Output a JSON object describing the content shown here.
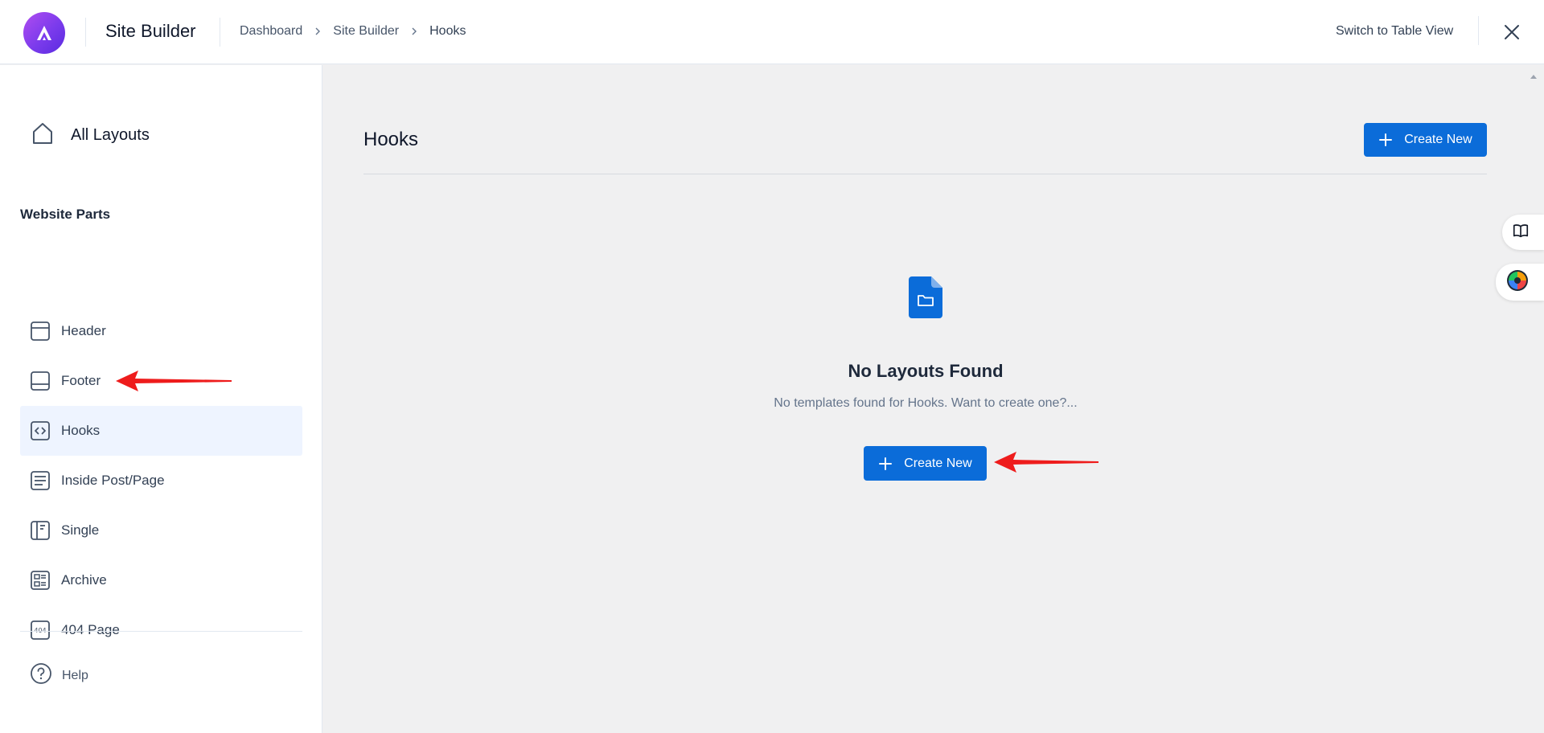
{
  "header": {
    "app_title": "Site Builder",
    "breadcrumb": [
      "Dashboard",
      "Site Builder",
      "Hooks"
    ],
    "switch_view_label": "Switch to Table View",
    "icons": {
      "logo": "astra-logo-icon",
      "close": "close-icon",
      "separator": "chevron-right-icon"
    }
  },
  "sidebar": {
    "all_layouts_label": "All Layouts",
    "section_title": "Website Parts",
    "items": [
      {
        "label": "Header",
        "icon": "header-layout-icon",
        "active": false
      },
      {
        "label": "Footer",
        "icon": "footer-layout-icon",
        "active": false
      },
      {
        "label": "Hooks",
        "icon": "code-icon",
        "active": true
      },
      {
        "label": "Inside Post/Page",
        "icon": "inside-post-icon",
        "active": false
      },
      {
        "label": "Single",
        "icon": "single-layout-icon",
        "active": false
      },
      {
        "label": "Archive",
        "icon": "archive-layout-icon",
        "active": false
      },
      {
        "label": "404 Page",
        "icon": "404-page-icon",
        "active": false
      }
    ],
    "help_label": "Help"
  },
  "main": {
    "title": "Hooks",
    "create_new_label": "Create New",
    "empty_state": {
      "title": "No Layouts Found",
      "description": "No templates found for Hooks. Want to create one?...",
      "create_new_label": "Create New",
      "icon": "file-folder-icon"
    }
  },
  "colors": {
    "primary": "#0b6cd9",
    "logo_gradient_start": "#b04df0",
    "logo_gradient_end": "#5a2be0",
    "active_bg": "#eef4ff",
    "annotation_arrow": "#ee1c1c",
    "main_bg": "#f0f0f1"
  }
}
